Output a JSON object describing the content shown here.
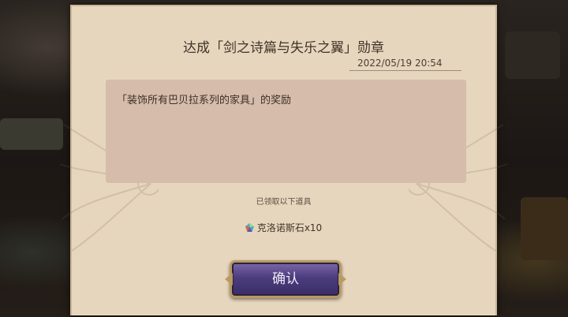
{
  "dialog": {
    "title": "达成「剑之诗篇与失乐之翼」勋章",
    "datetime": "2022/05/19 20:54",
    "reward_description": "「装饰所有巴贝拉系列的家具」的奖励",
    "received_label": "已领取以下道具",
    "item": {
      "icon": "chronos-stone-icon",
      "label": "克洛诺斯石x10"
    },
    "confirm_label": "确认"
  },
  "colors": {
    "panel": "#e7d6be",
    "reward_box": "#d6bcaa",
    "button": "#4c3c7e",
    "button_border": "#b89a62"
  }
}
